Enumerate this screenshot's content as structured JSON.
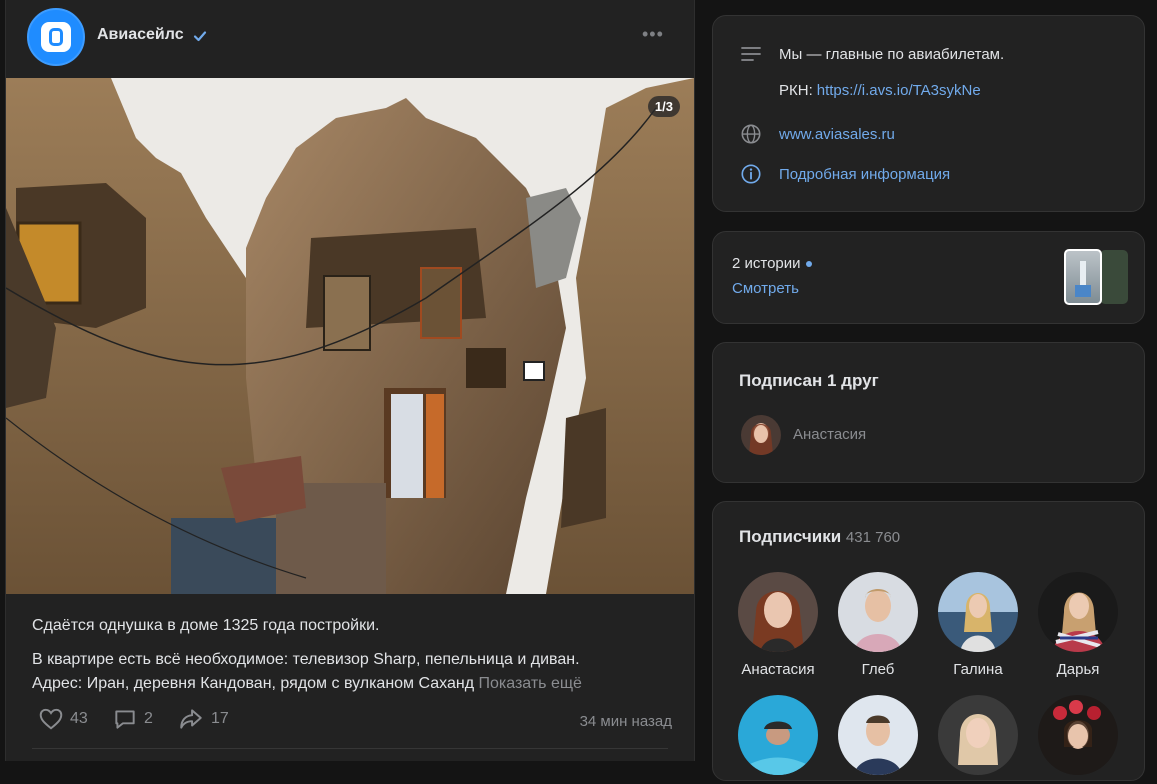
{
  "post": {
    "author": "Авиасейлс",
    "more_icon": "•••",
    "photo_counter": "1/3",
    "text_line1": "Сдаётся однушка в доме 1325 года постройки.",
    "text_line2": "В квартире есть всё необходимое: телевизор Sharp, пепельница и диван.",
    "text_line3": "Адрес: Иран, деревня Кандован, рядом с вулканом Саханд",
    "show_more": "Показать ещё",
    "likes": "43",
    "comments": "2",
    "shares": "17",
    "time": "34 мин назад"
  },
  "info": {
    "description": "Мы — главные по авиабилетам.",
    "rkn_label": "РКН: ",
    "rkn_link": "https://i.avs.io/TA3sykNe",
    "website": "www.aviasales.ru",
    "details": "Подробная информация"
  },
  "stories": {
    "title": "2 истории",
    "link": "Смотреть"
  },
  "friends": {
    "title": "Подписан 1 друг",
    "name": "Анастасия"
  },
  "subscribers": {
    "title": "Подписчики",
    "count": "431 760",
    "people": [
      {
        "name": "Анастасия"
      },
      {
        "name": "Глеб"
      },
      {
        "name": "Галина"
      },
      {
        "name": "Дарья"
      },
      {
        "name": ""
      },
      {
        "name": ""
      },
      {
        "name": ""
      },
      {
        "name": ""
      }
    ]
  },
  "colors": {
    "accent": "#71aaeb",
    "brand": "#1f8cff",
    "background": "#141414",
    "card": "#222222"
  }
}
